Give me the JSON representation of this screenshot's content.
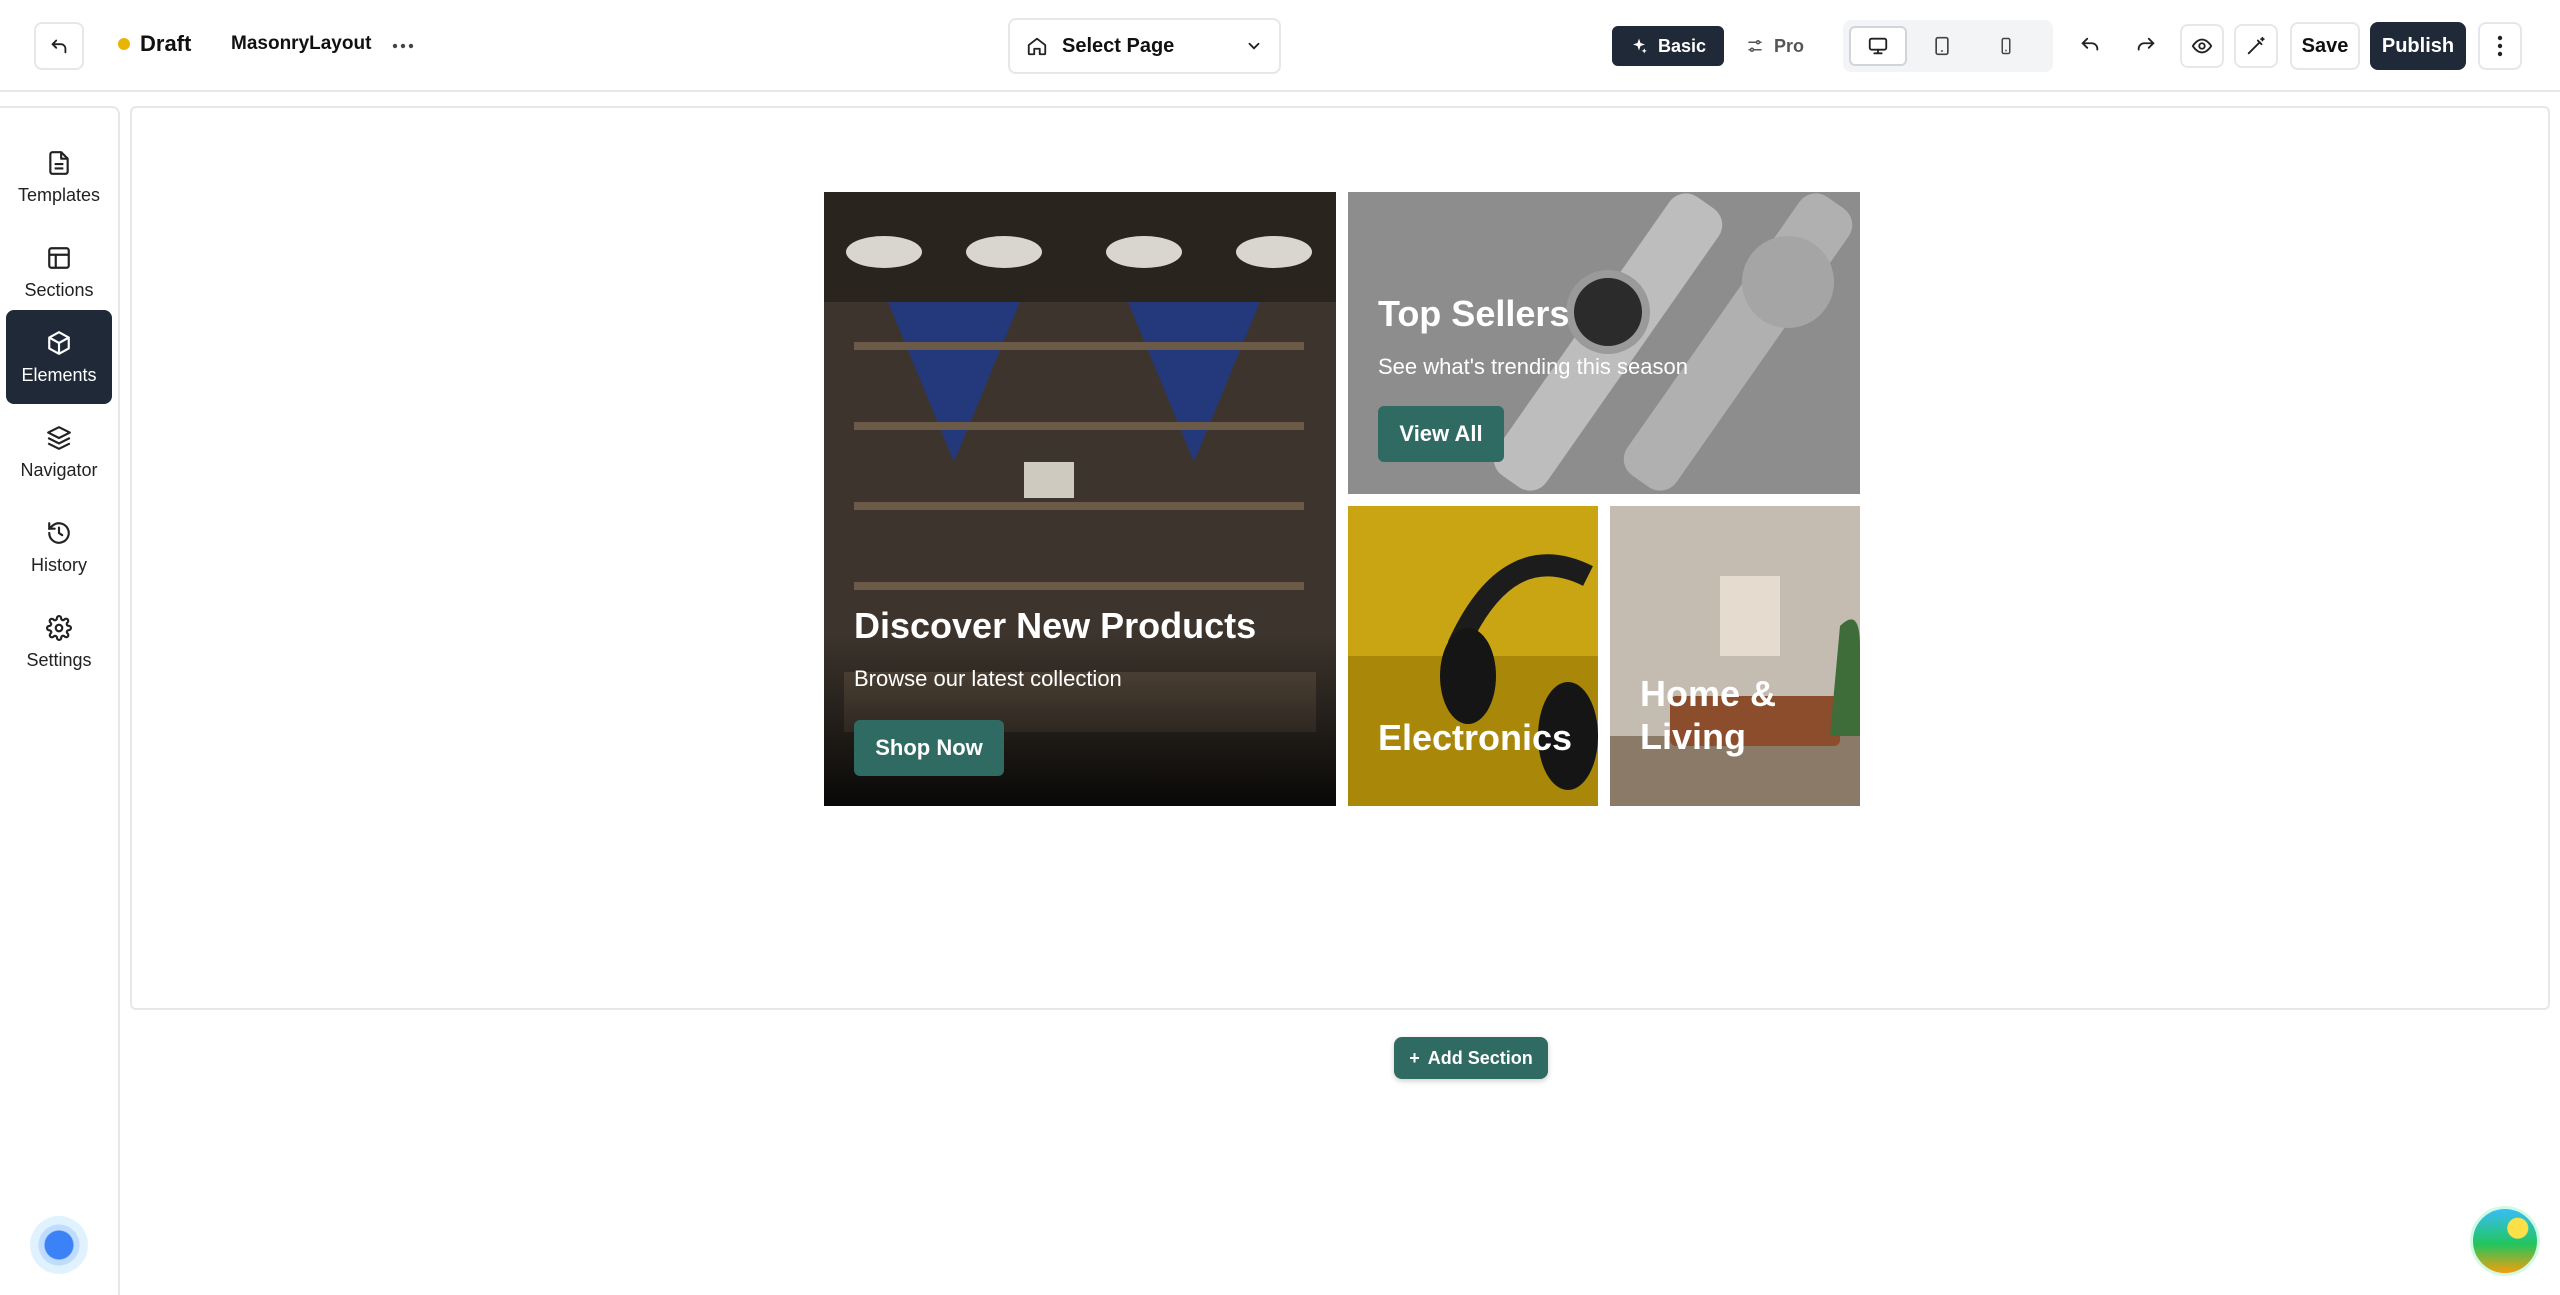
{
  "header": {
    "status_label": "Draft",
    "page_name": "MasonryLayout",
    "page_select_label": "Select Page",
    "mode_basic": "Basic",
    "mode_pro": "Pro",
    "save_label": "Save",
    "publish_label": "Publish"
  },
  "sidebar": {
    "items": [
      {
        "label": "Templates",
        "icon": "document-icon"
      },
      {
        "label": "Sections",
        "icon": "layout-icon"
      },
      {
        "label": "Elements",
        "icon": "cube-icon"
      },
      {
        "label": "Navigator",
        "icon": "layers-icon"
      },
      {
        "label": "History",
        "icon": "history-icon"
      },
      {
        "label": "Settings",
        "icon": "gear-icon"
      }
    ],
    "active": "Elements"
  },
  "tiles": {
    "discover": {
      "title": "Discover New Products",
      "subtitle": "Browse our latest collection",
      "button": "Shop Now"
    },
    "top_sellers": {
      "title": "Top Sellers",
      "subtitle": "See what's trending this season",
      "button": "View All"
    },
    "electronics": {
      "title": "Electronics"
    },
    "home": {
      "title": "Home & Living"
    }
  },
  "canvas": {
    "add_section_label": "Add Section"
  },
  "colors": {
    "accent": "#2f6b63",
    "dark": "#1f2937",
    "draft_dot": "#eab308"
  }
}
